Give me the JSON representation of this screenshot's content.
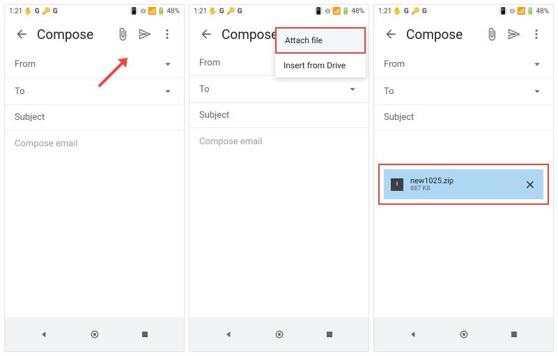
{
  "status": {
    "time": "1:21",
    "battery_pct": "48%"
  },
  "compose": {
    "title": "Compose",
    "from_label": "From",
    "to_label": "To",
    "subject_label": "Subject",
    "body_placeholder": "Compose email"
  },
  "popup": {
    "attach_file": "Attach file",
    "insert_drive": "Insert from Drive"
  },
  "attachment": {
    "filename": "new1025.zip",
    "filesize": "887 KB"
  }
}
